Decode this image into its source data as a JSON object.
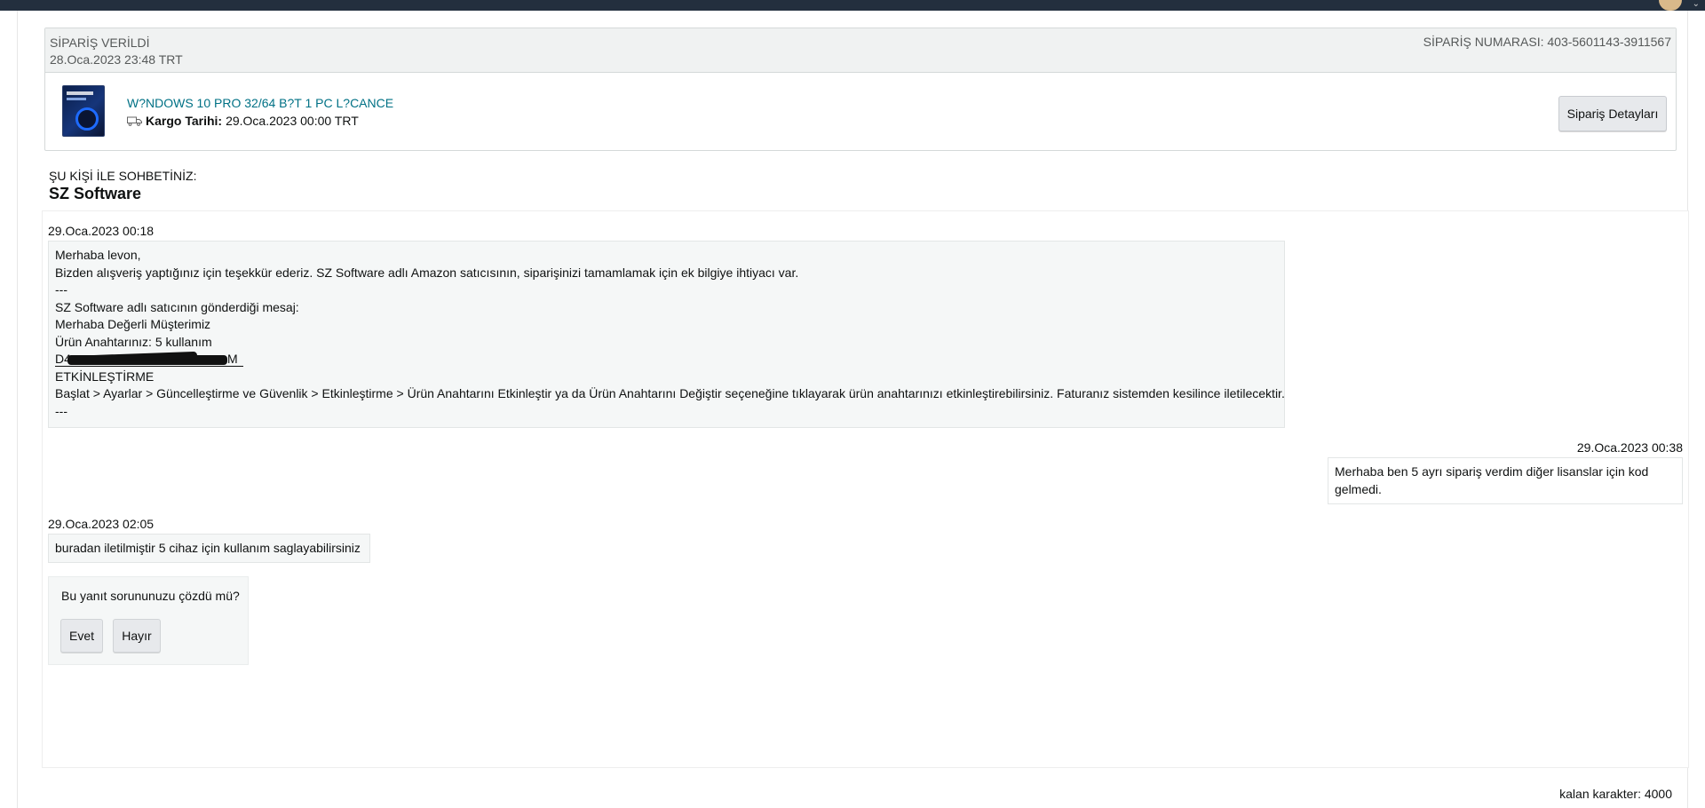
{
  "order": {
    "placed_label": "SİPARİŞ VERİLDİ",
    "placed_date": "28.Oca.2023 23:48 TRT",
    "order_number_text": "SİPARİŞ NUMARASI: 403-5601143-3911567",
    "product_title": "W?NDOWS 10 PRO 32/64 B?T 1 PC L?CANCE",
    "ship_label": "Kargo Tarihi:",
    "ship_date": "29.Oca.2023 00:00 TRT",
    "details_button": "Sipariş Detayları"
  },
  "chat": {
    "with_label": "ŞU KİŞİ İLE SOHBETİNİZ:",
    "seller_name": "SZ Software"
  },
  "messages": [
    {
      "time": "29.Oca.2023 00:18",
      "lines": [
        "Merhaba levon,",
        "Bizden alışveriş yaptığınız için teşekkür ederiz. SZ Software adlı Amazon satıcısının, siparişinizi tamamlamak için ek bilgiye ihtiyacı var.",
        "---",
        "SZ Software adlı satıcının gönderdiği mesaj:",
        "Merhaba Değerli Müşterimiz",
        "Ürün Anahtarınız: 5 kullanım"
      ],
      "key_prefix": "D4",
      "key_tail": "M",
      "lines_after": [
        "ETKİNLEŞTİRME",
        "Başlat > Ayarlar > Güncelleştirme ve Güvenlik > Etkinleştirme > Ürün Anahtarını Etkinleştir ya da Ürün Anahtarını Değiştir seçeneğine tıklayarak ürün anahtarınızı etkinleştirebilirsiniz. Faturanız sistemden kesilince iletilecektir.",
        "---"
      ]
    },
    {
      "time": "29.Oca.2023 00:38",
      "lines": [
        "Merhaba ben 5 ayrı sipariş verdim diğer lisanslar için kod",
        "gelmedi."
      ]
    },
    {
      "time": "29.Oca.2023 02:05",
      "lines": [
        "buradan iletilmiştir 5 cihaz için kullanım saglayabilirsiniz"
      ]
    }
  ],
  "feedback": {
    "question": "Bu yanıt sorununuzu çözdü mü?",
    "yes": "Evet",
    "no": "Hayır"
  },
  "remaining_chars": "kalan karakter: 4000",
  "icons": {
    "truck": "truck-icon",
    "product_image": "product-thumbnail"
  }
}
